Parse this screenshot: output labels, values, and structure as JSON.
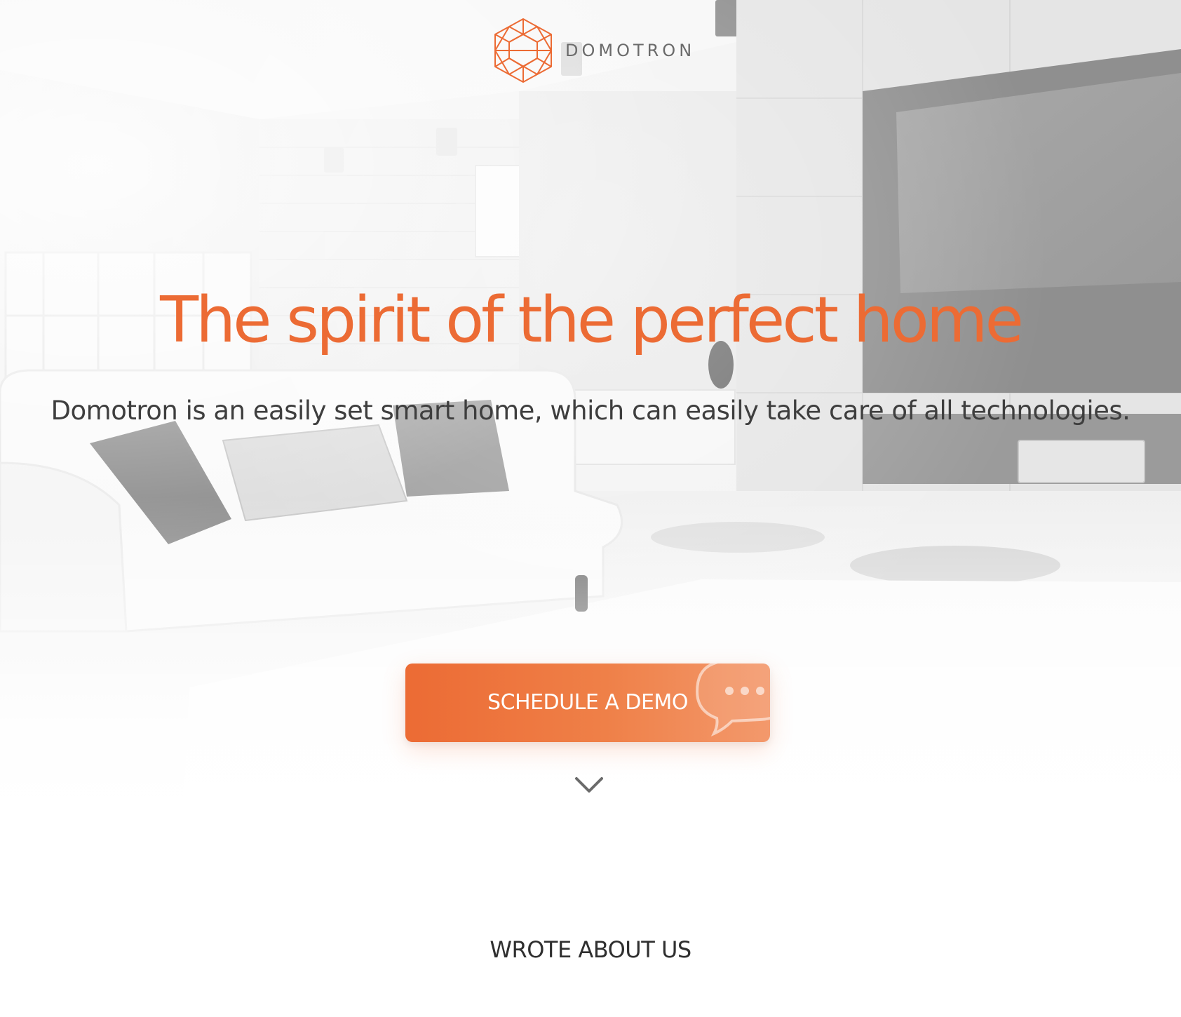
{
  "brand": {
    "name": "DOMOTRON",
    "logo_icon": "hexagon-cube-logo-icon",
    "accent_color": "#ec6b34"
  },
  "hero": {
    "headline": "The spirit of the perfect home",
    "subheadline": "Domotron is an easily set smart home, which can easily take care of all technologies.",
    "background": "living-room-photo",
    "cta": {
      "label": "SCHEDULE A DEMO",
      "icon": "speech-bubble-icon"
    },
    "scroll_icon": "chevron-down-icon"
  },
  "press": {
    "title": "WROTE ABOUT US"
  }
}
